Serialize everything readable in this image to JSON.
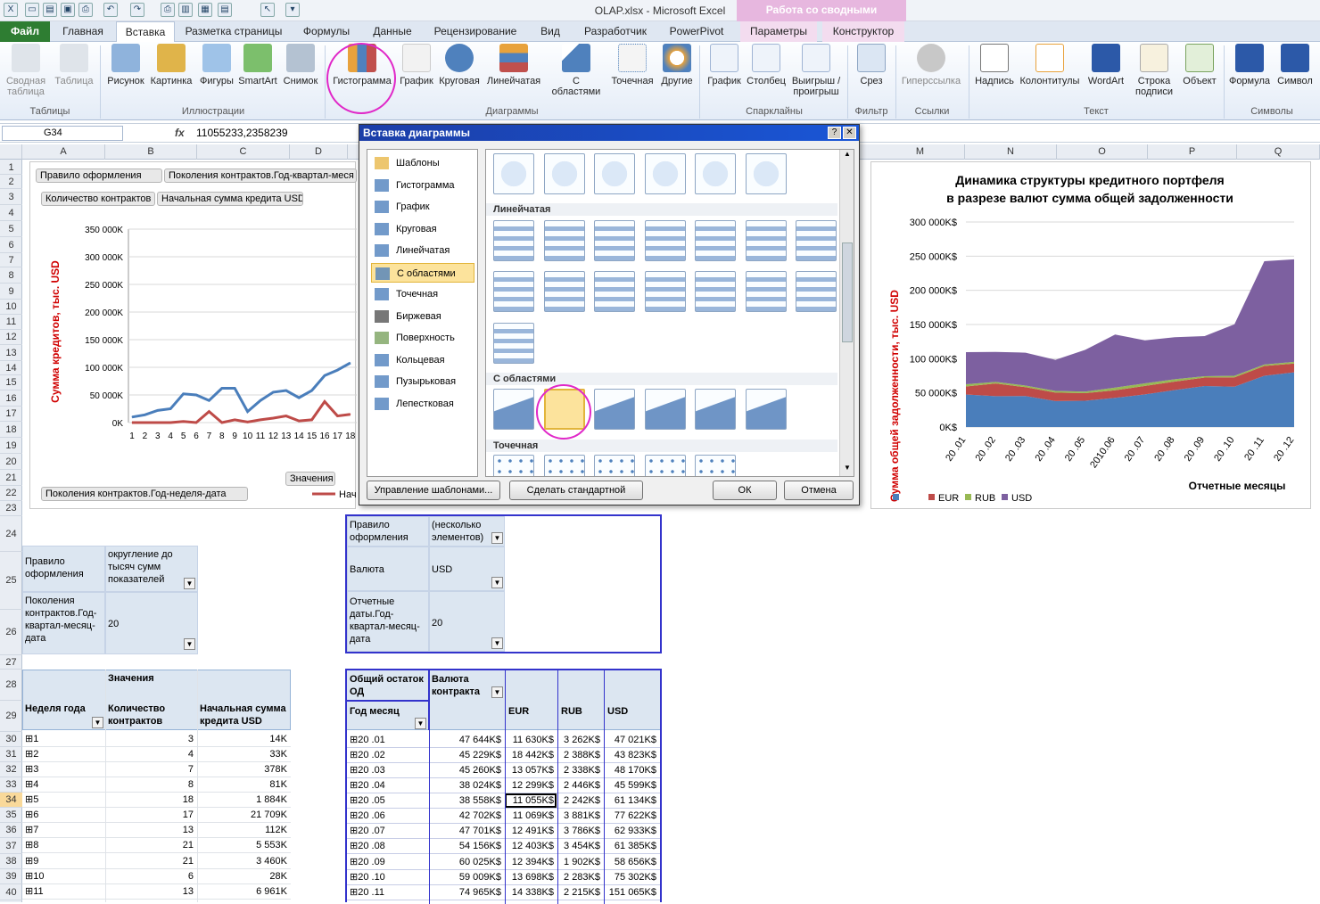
{
  "window": {
    "title": "OLAP.xlsx  -  Microsoft Excel",
    "context_tab_header": "Работа со сводными таблицами"
  },
  "tabs": [
    "Файл",
    "Главная",
    "Вставка",
    "Разметка страницы",
    "Формулы",
    "Данные",
    "Рецензирование",
    "Вид",
    "Разработчик",
    "PowerPivot",
    "Параметры",
    "Конструктор"
  ],
  "ribbon": {
    "buttons": [
      "Сводная таблица",
      "Таблица",
      "Рисунок",
      "Картинка",
      "Фигуры",
      "SmartArt",
      "Снимок",
      "Гистограмма",
      "График",
      "Круговая",
      "Линейчатая",
      "С областями",
      "Точечная",
      "Другие",
      "График",
      "Столбец",
      "Выигрыш / проигрыш",
      "Срез",
      "Гиперссылка",
      "Надпись",
      "Колонтитулы",
      "WordArt",
      "Строка подписи",
      "Объект",
      "Формула",
      "Символ"
    ],
    "groups": [
      "Таблицы",
      "Иллюстрации",
      "Диаграммы",
      "Спарклайны",
      "Фильтр",
      "Ссылки",
      "Текст",
      "Символы"
    ]
  },
  "formula_bar": {
    "name_box": "G34",
    "fx": "fx",
    "formula": "11055233,2358239"
  },
  "columns": [
    "A",
    "B",
    "C",
    "D",
    "M",
    "N",
    "O",
    "P",
    "Q"
  ],
  "rows": [
    "1",
    "2",
    "3",
    "4",
    "5",
    "6",
    "7",
    "8",
    "9",
    "10",
    "11",
    "12",
    "13",
    "14",
    "15",
    "16",
    "17",
    "18",
    "19",
    "20",
    "21",
    "22",
    "23",
    "24",
    "25",
    "26",
    "27",
    "28",
    "29",
    "30",
    "31",
    "32",
    "33",
    "34",
    "35",
    "36",
    "37",
    "38",
    "39",
    "40"
  ],
  "left_chart": {
    "buttons": [
      "Правило оформления",
      "Поколения контрактов.Год-квартал-меся",
      "Количество контрактов",
      "Начальная сумма кредита USD",
      "Значения",
      "Поколения контрактов.Год-неделя-дата"
    ],
    "legend": "Нач",
    "chart_data": {
      "type": "line",
      "ylabel": "Сумма кредитов, тыс. USD",
      "ylim": [
        0,
        350000
      ],
      "yticks": [
        "350 000K",
        "300 000K",
        "250 000K",
        "200 000K",
        "150 000K",
        "100 000K",
        "50 000K",
        "0K"
      ],
      "categories": [
        "1",
        "2",
        "3",
        "4",
        "5",
        "6",
        "7",
        "8",
        "9",
        "10",
        "11",
        "12",
        "13",
        "14",
        "15",
        "16",
        "17",
        "18"
      ],
      "series": [
        {
          "name": "",
          "values": [
            10000,
            14000,
            22000,
            25000,
            52000,
            50000,
            40000,
            62000,
            62000,
            20000,
            40000,
            55000,
            58000,
            45000,
            58000,
            85000,
            95000,
            108000
          ]
        },
        {
          "name": "Нач",
          "values": [
            0,
            0,
            0,
            0,
            2000,
            0,
            20000,
            0,
            5000,
            1000,
            5000,
            8000,
            12000,
            3000,
            5000,
            38000,
            12000,
            15000
          ]
        }
      ]
    }
  },
  "right_chart": {
    "chart_data": {
      "type": "area",
      "title": "Динамика структуры кредитного портфеля\nв разрезе  валют сумма общей задолженности",
      "ylabel": "Сумма общей задолженности, тыс. USD",
      "xlabel": "Отчетные месяцы",
      "ylim": [
        0,
        300000
      ],
      "yticks": [
        "300 000K$",
        "250 000K$",
        "200 000K$",
        "150 000K$",
        "100 000K$",
        "50 000K$",
        "0K$"
      ],
      "categories": [
        "20 .01",
        "20 .02",
        "20 .03",
        "20 .04",
        "20 .05",
        "2010.06",
        "20 .07",
        "20 .08",
        "20 .09",
        "20 .10",
        "20 .11",
        "20 .12"
      ],
      "series": [
        {
          "name": "",
          "color": "#4a7ebb",
          "values": [
            47644,
            45229,
            45260,
            38024,
            38558,
            42702,
            47701,
            54156,
            60025,
            59009,
            74965,
            80000
          ]
        },
        {
          "name": "EUR",
          "color": "#be4b48",
          "values": [
            11630,
            18442,
            13057,
            12299,
            11055,
            11069,
            12491,
            12403,
            12394,
            13698,
            14338,
            13000
          ]
        },
        {
          "name": "RUB",
          "color": "#98b954",
          "values": [
            3262,
            2388,
            2338,
            2446,
            2242,
            3881,
            3786,
            3454,
            1902,
            2283,
            2215,
            2400
          ]
        },
        {
          "name": "USD",
          "color": "#7d60a0",
          "values": [
            47021,
            43823,
            48170,
            45599,
            61134,
            77622,
            62933,
            61385,
            58656,
            75302,
            151065,
            150000
          ]
        }
      ]
    }
  },
  "pivot_left_filter": {
    "r1a": "Правило оформления",
    "r1b": "округление до тысяч сумм показателей",
    "r2a": "Поколения контрактов.Год-квартал-месяц-дата",
    "r2b": "20"
  },
  "pivot_left": {
    "values_label": "Значения",
    "col_headers": [
      "Неделя года",
      "Количество контрактов",
      "Начальная сумма кредита USD"
    ],
    "rows": [
      [
        "1",
        "3",
        "14K"
      ],
      [
        "2",
        "4",
        "33K"
      ],
      [
        "3",
        "7",
        "378K"
      ],
      [
        "4",
        "8",
        "81K"
      ],
      [
        "5",
        "18",
        "1 884K"
      ],
      [
        "6",
        "17",
        "21 709K"
      ],
      [
        "7",
        "13",
        "112K"
      ],
      [
        "8",
        "21",
        "5 553K"
      ],
      [
        "9",
        "21",
        "3 460K"
      ],
      [
        "10",
        "6",
        "28K"
      ],
      [
        "11",
        "13",
        "6 961K"
      ]
    ]
  },
  "pivot_right_filter": {
    "r1a": "Правило оформления",
    "r1b": "(несколько элементов)",
    "r2a": "Валюта",
    "r2b": "USD",
    "r3a": "Отчетные даты.Год-квартал-месяц-дата",
    "r3b": "20"
  },
  "pivot_right": {
    "corner": "Общий остаток ОД",
    "col_field": "Валюта контракта",
    "row_field": "Год месяц",
    "col_headers": [
      "",
      "EUR",
      "RUB",
      "USD"
    ],
    "rows": [
      [
        "20 .01",
        "47 644K$",
        "11 630K$",
        "3 262K$",
        "47 021K$"
      ],
      [
        "20 .02",
        "45 229K$",
        "18 442K$",
        "2 388K$",
        "43 823K$"
      ],
      [
        "20 .03",
        "45 260K$",
        "13 057K$",
        "2 338K$",
        "48 170K$"
      ],
      [
        "20 .04",
        "38 024K$",
        "12 299K$",
        "2 446K$",
        "45 599K$"
      ],
      [
        "20 .05",
        "38 558K$",
        "11 055K$",
        "2 242K$",
        "61 134K$"
      ],
      [
        "20 .06",
        "42 702K$",
        "11 069K$",
        "3 881K$",
        "77 622K$"
      ],
      [
        "20 .07",
        "47 701K$",
        "12 491K$",
        "3 786K$",
        "62 933K$"
      ],
      [
        "20 .08",
        "54 156K$",
        "12 403K$",
        "3 454K$",
        "61 385K$"
      ],
      [
        "20 .09",
        "60 025K$",
        "12 394K$",
        "1 902K$",
        "58 656K$"
      ],
      [
        "20 .10",
        "59 009K$",
        "13 698K$",
        "2 283K$",
        "75 302K$"
      ],
      [
        "20 .11",
        "74 965K$",
        "14 338K$",
        "2 215K$",
        "151 065K$"
      ]
    ]
  },
  "dialog": {
    "title": "Вставка диаграммы",
    "help": "?",
    "close": "✕",
    "categories": [
      "Шаблоны",
      "Гистограмма",
      "График",
      "Круговая",
      "Линейчатая",
      "С областями",
      "Точечная",
      "Биржевая",
      "Поверхность",
      "Кольцевая",
      "Пузырьковая",
      "Лепестковая"
    ],
    "selected_category": "С областями",
    "section_bar": "Линейчатая",
    "section_area": "С областями",
    "section_scatter": "Точечная",
    "btn_manage": "Управление шаблонами...",
    "btn_default": "Сделать стандартной",
    "btn_ok": "ОК",
    "btn_cancel": "Отмена"
  }
}
